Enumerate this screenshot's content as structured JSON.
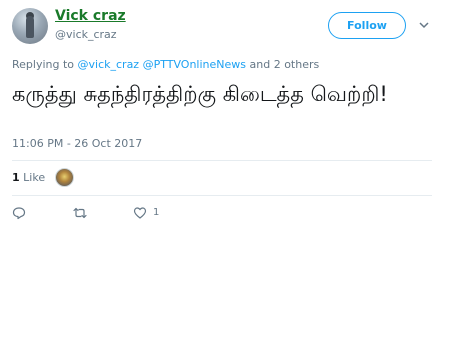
{
  "user": {
    "display_name": "Vick craz",
    "handle": "@vick_craz"
  },
  "follow_button": {
    "label": "Follow"
  },
  "reply": {
    "prefix": "Replying to",
    "mention_1": "@vick_craz",
    "mention_2": "@PTTVOnlineNews",
    "suffix": "and 2 others"
  },
  "tweet": {
    "text": "கருத்து சுதந்திரத்திற்கு கிடைத்த வெற்றி!",
    "timestamp": "11:06 PM - 26 Oct 2017"
  },
  "stats": {
    "like_count": "1",
    "like_label": "Like"
  },
  "actions": {
    "like_count": "1"
  },
  "colors": {
    "accent": "#1da1f2",
    "name_color": "#1a7a2a",
    "muted": "#657786"
  },
  "icons": [
    "chevron-down-icon",
    "reply-icon",
    "retweet-icon",
    "heart-icon"
  ]
}
